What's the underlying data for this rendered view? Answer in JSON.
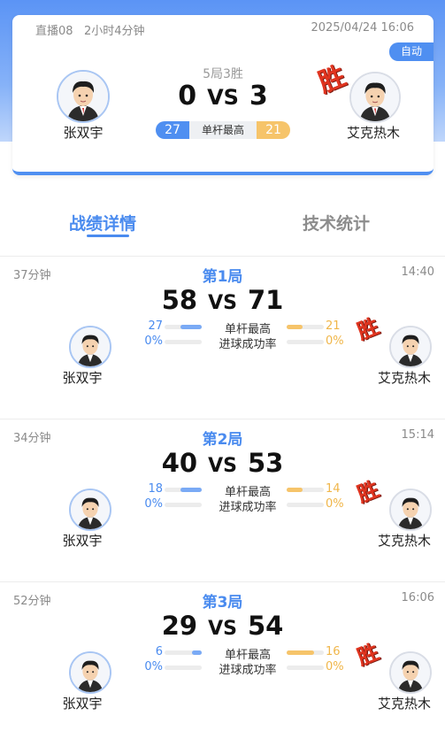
{
  "match": {
    "live_label": "直播08",
    "elapsed": "2小时4分钟",
    "date": "2025/04/24 16:06",
    "auto_label": "自动",
    "format": "5局3胜",
    "score_left": "0",
    "vs": "VS",
    "score_right": "3",
    "highest_break_left": "27",
    "highest_break_label": "单杆最高",
    "highest_break_right": "21",
    "player_left": "张双宇",
    "player_right": "艾克热木",
    "winner_stamp": "胜"
  },
  "tabs": [
    {
      "label": "战绩详情",
      "active": true
    },
    {
      "label": "技术统计",
      "active": false
    }
  ],
  "games": [
    {
      "duration": "37分钟",
      "title": "第1局",
      "time": "14:40",
      "score_left": "58",
      "vs": "VS",
      "score_right": "71",
      "highest_break_label": "单杆最高",
      "highest_left": "27",
      "highest_right": "21",
      "highest_left_ratio": 0.56,
      "highest_right_ratio": 0.44,
      "potting_label": "进球成功率",
      "potting_left": "0%",
      "potting_right": "0%",
      "potting_left_ratio": 0,
      "potting_right_ratio": 0,
      "player_left": "张双宇",
      "player_right": "艾克热木",
      "winner_stamp": "胜"
    },
    {
      "duration": "34分钟",
      "title": "第2局",
      "time": "15:14",
      "score_left": "40",
      "vs": "VS",
      "score_right": "53",
      "highest_break_label": "单杆最高",
      "highest_left": "18",
      "highest_right": "14",
      "highest_left_ratio": 0.56,
      "highest_right_ratio": 0.44,
      "potting_label": "进球成功率",
      "potting_left": "0%",
      "potting_right": "0%",
      "potting_left_ratio": 0,
      "potting_right_ratio": 0,
      "player_left": "张双宇",
      "player_right": "艾克热木",
      "winner_stamp": "胜"
    },
    {
      "duration": "52分钟",
      "title": "第3局",
      "time": "16:06",
      "score_left": "29",
      "vs": "VS",
      "score_right": "54",
      "highest_break_label": "单杆最高",
      "highest_left": "6",
      "highest_right": "16",
      "highest_left_ratio": 0.27,
      "highest_right_ratio": 0.73,
      "potting_label": "进球成功率",
      "potting_left": "0%",
      "potting_right": "0%",
      "potting_left_ratio": 0,
      "potting_right_ratio": 0,
      "player_left": "张双宇",
      "player_right": "艾克热木",
      "winner_stamp": "胜"
    }
  ],
  "colors": {
    "accent": "#4a8bef",
    "opponent": "#f6c46a",
    "win": "#e0341f"
  }
}
